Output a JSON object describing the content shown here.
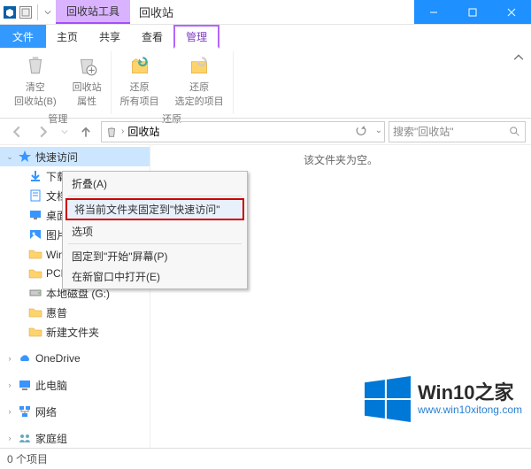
{
  "title": "回收站",
  "contextual_tab": "回收站工具",
  "tabs": {
    "file": "文件",
    "home": "主页",
    "share": "共享",
    "view": "查看",
    "manage": "管理"
  },
  "ribbon": {
    "group1": {
      "items": [
        "清空\n回收站(B)",
        "回收站\n属性"
      ],
      "label": "管理"
    },
    "group2": {
      "items": [
        "还原\n所有项目",
        "还原\n选定的项目"
      ],
      "label": "还原"
    }
  },
  "address": {
    "location": "回收站",
    "refresh": "刷新"
  },
  "search": {
    "placeholder": "搜索\"回收站\""
  },
  "tree": {
    "quick": "快速访问",
    "download": "下载",
    "docs": "文档",
    "desktop": "桌面",
    "pictures": "图片",
    "win10": "Win10预览版",
    "pcmark": "PCMark",
    "gdrive": "本地磁盘 (G:)",
    "huipu": "惠普",
    "newfolder": "新建文件夹",
    "onedrive": "OneDrive",
    "thispc": "此电脑",
    "network": "网络",
    "homegroup": "家庭组"
  },
  "content": {
    "empty": "该文件夹为空。"
  },
  "ctx": {
    "collapse": "折叠(A)",
    "pin": "将当前文件夹固定到\"快速访问\"",
    "options": "选项",
    "pinstart": "固定到\"开始\"屏幕(P)",
    "newwindow": "在新窗口中打开(E)"
  },
  "status": {
    "items": "0 个项目"
  },
  "watermark": {
    "main": "Win10之家",
    "sub": "www.win10xitong.com"
  }
}
